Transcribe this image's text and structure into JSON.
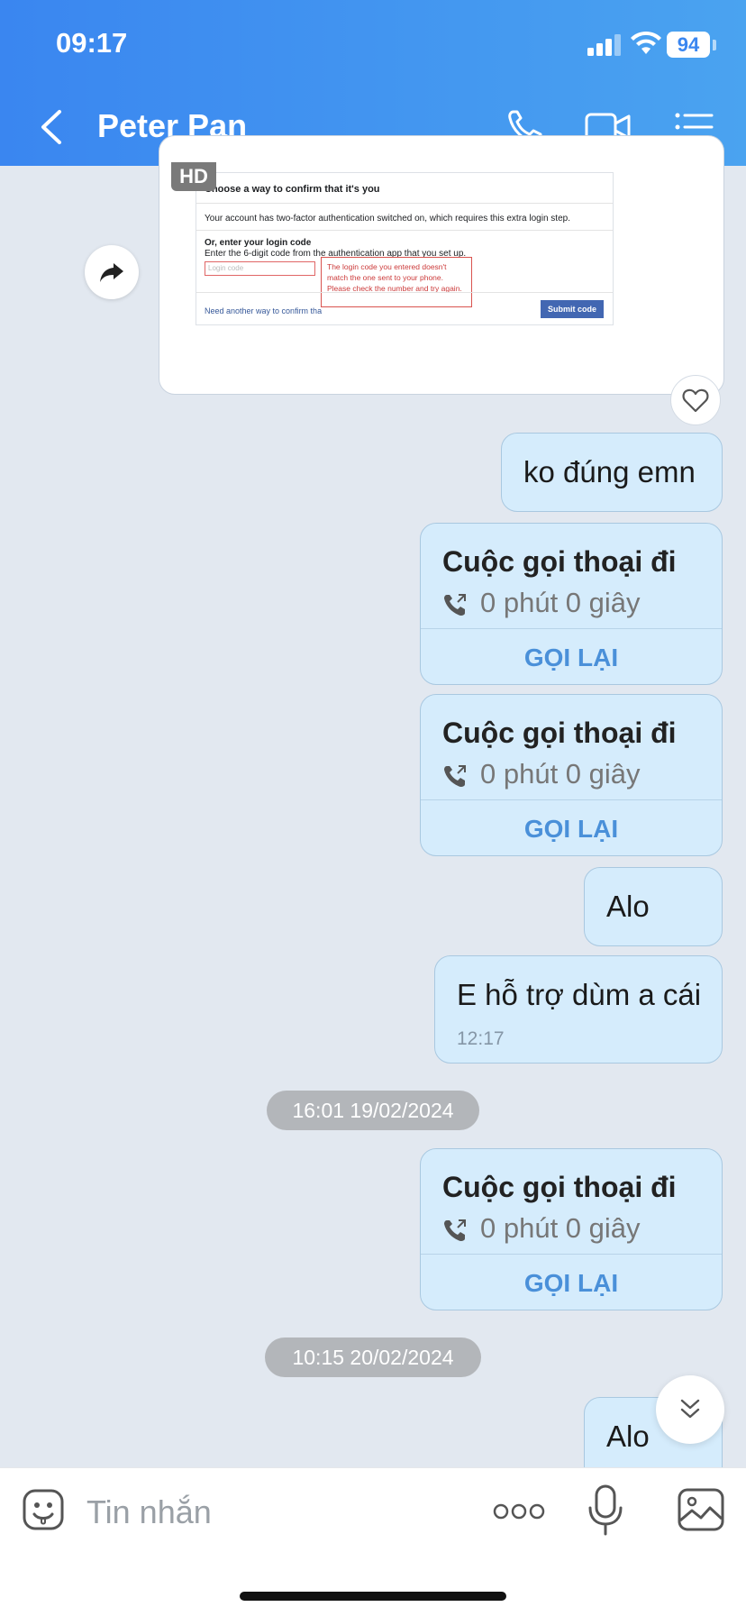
{
  "status_bar": {
    "time": "09:17",
    "battery": "94"
  },
  "header": {
    "back_icon": "chevron-left-icon",
    "title": "Peter Pan",
    "icons": [
      "phone-icon",
      "video-camera-icon",
      "menu-list-icon"
    ]
  },
  "image_message": {
    "badge": "HD",
    "screenshot": {
      "title": "Choose a way to confirm that it's you",
      "p1": "Your account has two-factor authentication switched on, which requires this extra login step.",
      "p2": "Or, enter your login code",
      "p3": "Enter the 6-digit code from the authentication app that you set up.",
      "input_placeholder": "Login code",
      "error": "The login code you entered doesn't match the one sent to your phone. Please check the number and try again.",
      "link": "Need another way to confirm tha",
      "submit": "Submit code"
    }
  },
  "messages": {
    "m1": "ko đúng emn",
    "call_title": "Cuộc gọi thoại đi",
    "call_duration": "0 phút 0 giây",
    "call_back": "GỌI LẠI",
    "m_alo": "Alo",
    "m_support": "E hỗ trợ dùm a cái",
    "m_support_time": "12:17",
    "date1": "16:01 19/02/2024",
    "date2": "10:15 20/02/2024"
  },
  "input_bar": {
    "placeholder": "Tin nhắn"
  },
  "colors": {
    "header_start": "#3a86f0",
    "header_end": "#4aa3f0",
    "bubble": "#d5ecfc",
    "link": "#4a90d9",
    "background": "#e2e8f0"
  }
}
